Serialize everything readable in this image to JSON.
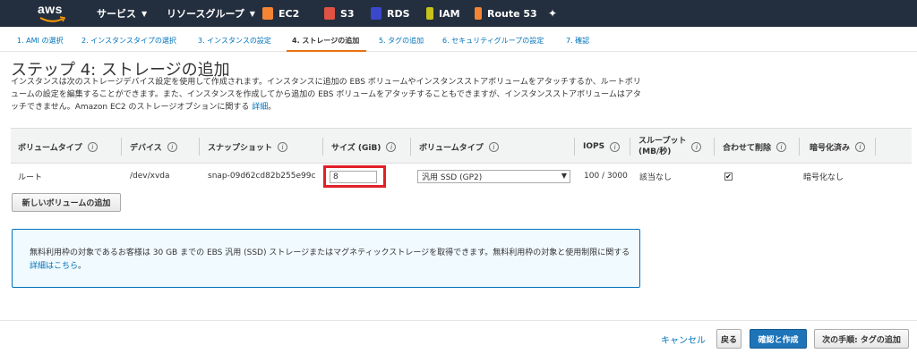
{
  "nav": {
    "logo": "aws",
    "services": "サービス",
    "resource_groups": "リソースグループ",
    "shortcuts": [
      {
        "label": "EC2",
        "color": "#f58534"
      },
      {
        "label": "S3",
        "color": "#e05243"
      },
      {
        "label": "RDS",
        "color": "#3b48cc"
      },
      {
        "label": "IAM",
        "color": "#c7c21a"
      },
      {
        "label": "Route 53",
        "color": "#f58534"
      }
    ]
  },
  "steps": [
    "1. AMI の選択",
    "2. インスタンスタイプの選択",
    "3. インスタンスの設定",
    "4. ストレージの追加",
    "5. タグの追加",
    "6. セキュリティグループの設定",
    "7. 確認"
  ],
  "page": {
    "title": "ステップ 4: ストレージの追加",
    "description": "インスタンスは次のストレージデバイス設定を使用して作成されます。インスタンスに追加の EBS ボリュームやインスタンスストアボリュームをアタッチするか、ルートボリュームの設定を編集することができます。また、インスタンスを作成してから追加の EBS ボリュームをアタッチすることもできますが、インスタンスストアボリュームはアタッチできません。Amazon EC2 のストレージオプションに関する",
    "description_link": "詳細",
    "description_end": "。"
  },
  "table": {
    "headers": {
      "volume_type": "ボリュームタイプ",
      "device": "デバイス",
      "snapshot": "スナップショット",
      "size": "サイズ (GiB)",
      "ebs_type": "ボリュームタイプ",
      "iops": "IOPS",
      "throughput_line1": "スループット",
      "throughput_line2": "(MB/秒)",
      "delete_on_termination": "合わせて削除",
      "encrypted": "暗号化済み"
    },
    "row": {
      "volume_type": "ルート",
      "device": "/dev/xvda",
      "snapshot": "snap-09d62cd82b255e99c",
      "size": "8",
      "ebs_type": "汎用 SSD (GP2)",
      "iops": "100 / 3000",
      "throughput": "該当なし",
      "delete_on_termination": true,
      "encrypted": "暗号化なし"
    }
  },
  "add_volume_button": "新しいボリュームの追加",
  "notice": {
    "text": "無料利用枠の対象であるお客様は 30 GB までの EBS 汎用 (SSD) ストレージまたはマグネティックストレージを取得できます。無料利用枠の対象と使用制限に関する",
    "link": "詳細はこちら",
    "end": "。"
  },
  "footer": {
    "cancel": "キャンセル",
    "back": "戻る",
    "review_launch": "確認と作成",
    "next": "次の手順: タグの追加"
  }
}
